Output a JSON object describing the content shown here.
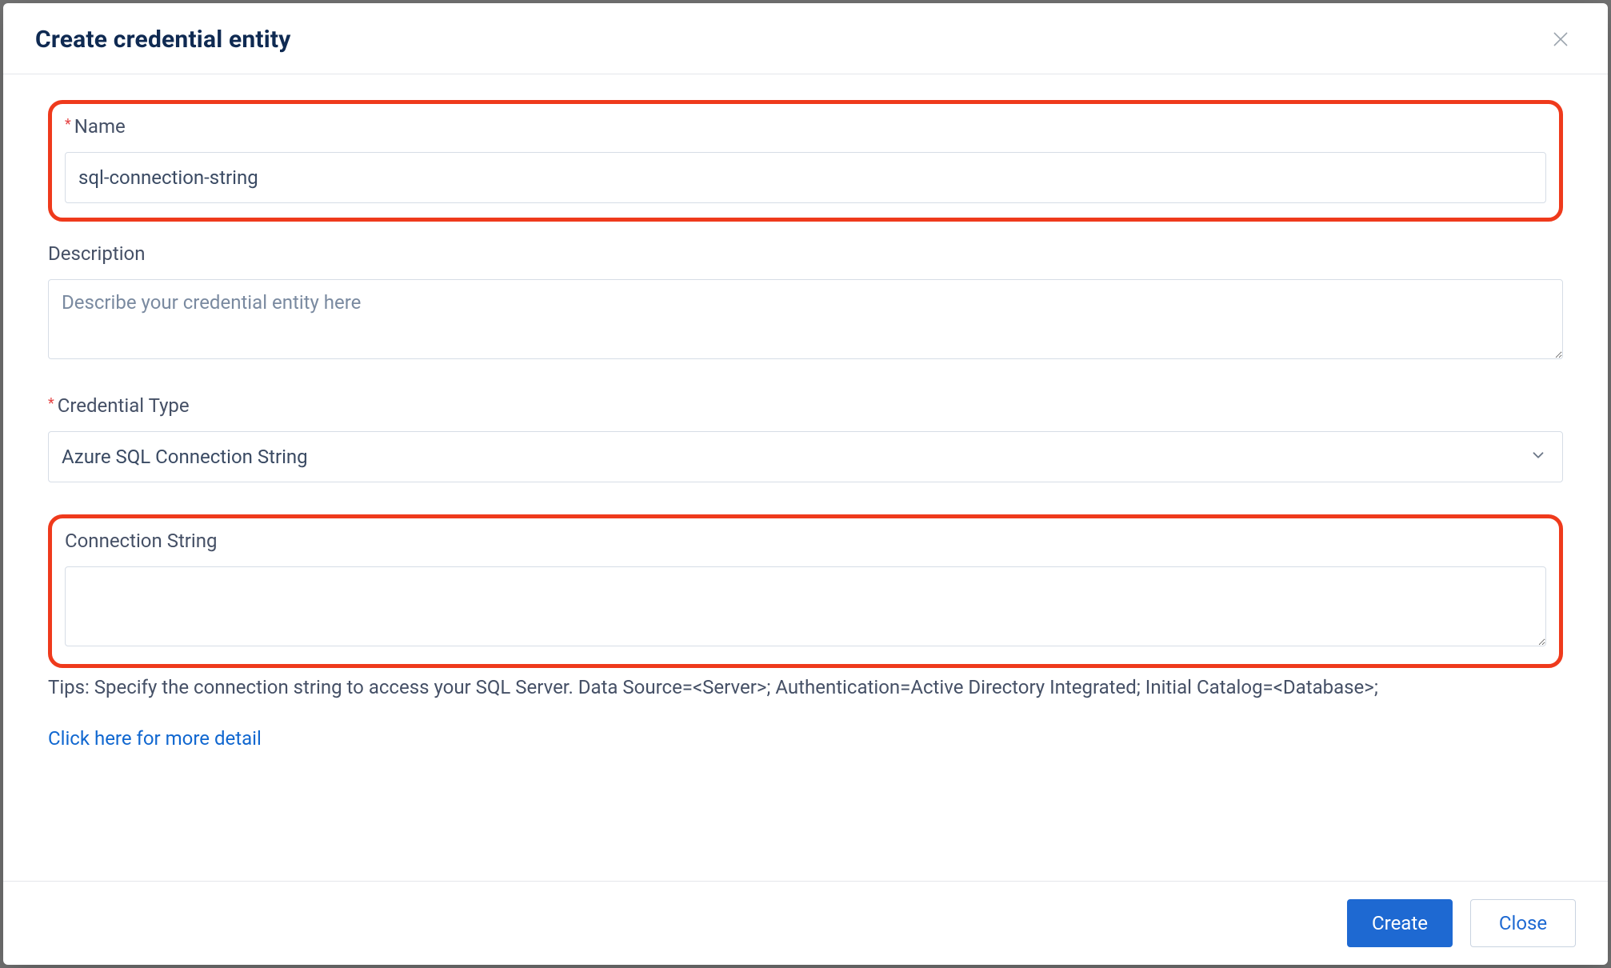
{
  "modal": {
    "title": "Create credential entity",
    "fields": {
      "name": {
        "label": "Name",
        "required": "*",
        "value": "sql-connection-string"
      },
      "description": {
        "label": "Description",
        "placeholder": "Describe your credential entity here",
        "value": ""
      },
      "credentialType": {
        "label": "Credential Type",
        "required": "*",
        "value": "Azure SQL Connection String"
      },
      "connectionString": {
        "label": "Connection String",
        "value": ""
      }
    },
    "tips": "Tips: Specify the connection string to access your SQL Server. Data Source=<Server>; Authentication=Active Directory Integrated; Initial Catalog=<Database>;",
    "moreLink": "Click here for more detail",
    "buttons": {
      "create": "Create",
      "close": "Close"
    }
  }
}
